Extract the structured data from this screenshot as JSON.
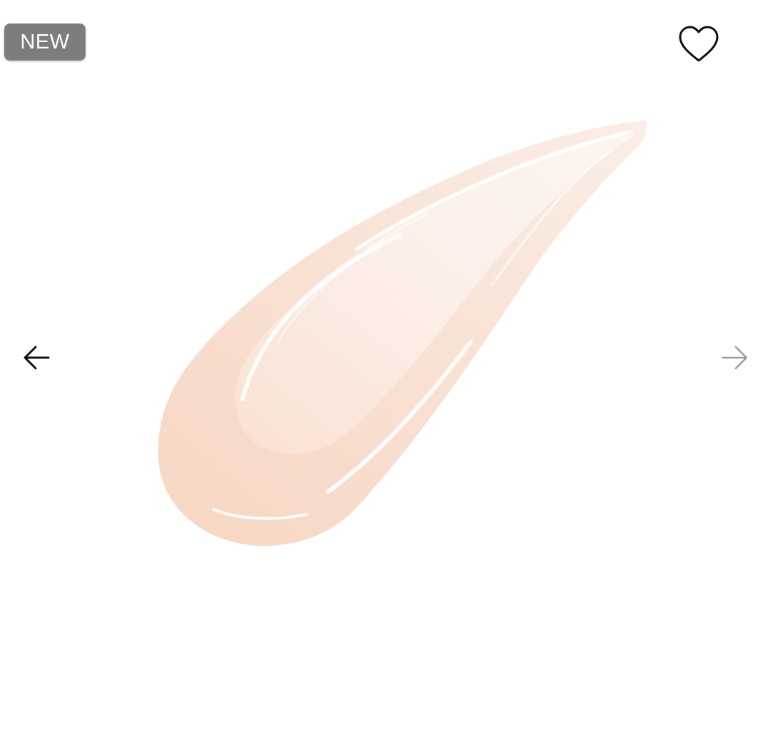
{
  "badge": {
    "label": "NEW"
  },
  "icons": {
    "favorite": "heart-outline-icon",
    "previous": "arrow-left-icon",
    "next": "arrow-right-icon"
  },
  "colors": {
    "badge_bg": "#7d7d7d",
    "arrow_active": "#111111",
    "arrow_inactive": "#9a9a9a",
    "swatch_base": "#f7dccb"
  },
  "gallery": {
    "has_previous": true,
    "has_next": false
  }
}
